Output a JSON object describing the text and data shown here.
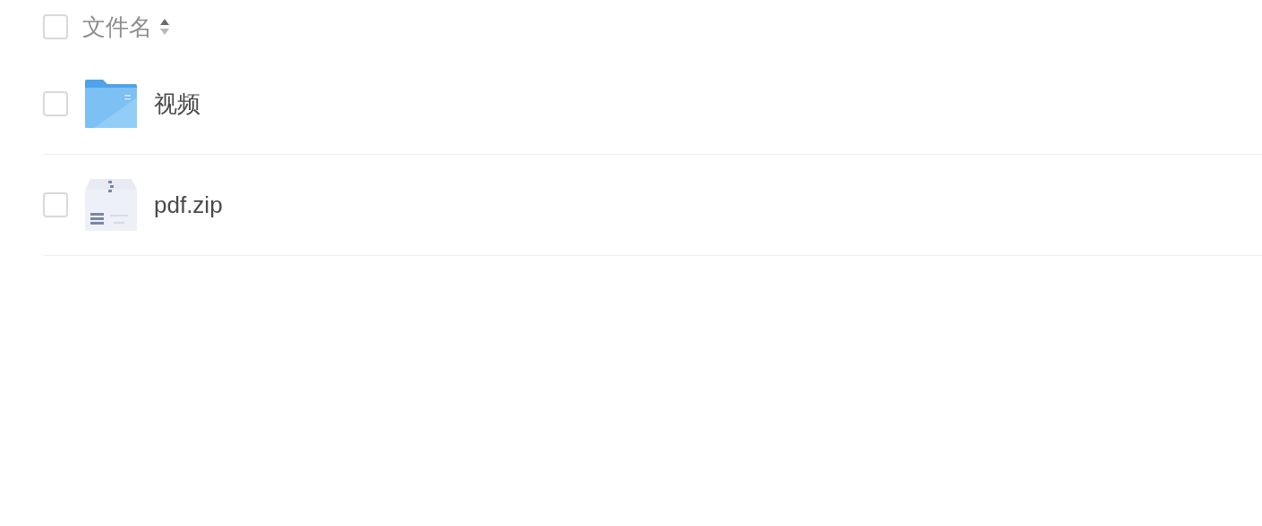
{
  "header": {
    "label": "文件名",
    "checked": false
  },
  "files": [
    {
      "name": "视频",
      "kind": "folder",
      "checked": false
    },
    {
      "name": "pdf.zip",
      "kind": "zip",
      "checked": false
    }
  ]
}
